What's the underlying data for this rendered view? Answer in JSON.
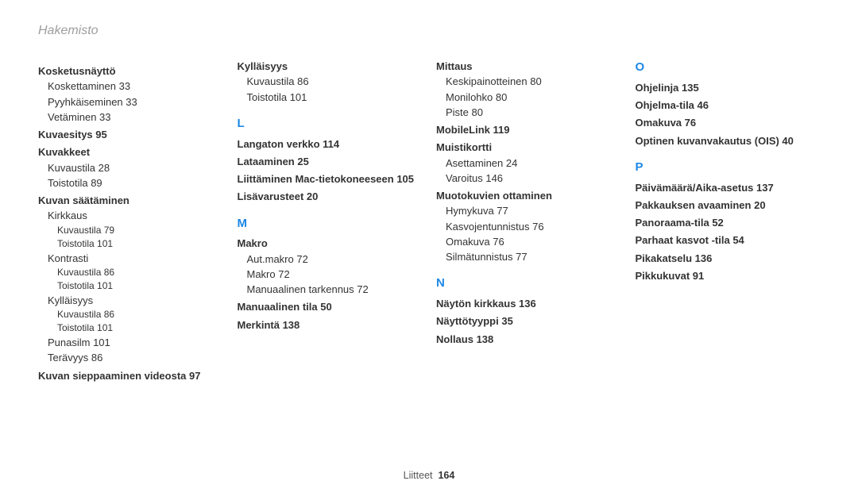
{
  "page_title": "Hakemisto",
  "footer": {
    "section": "Liitteet",
    "page": "164"
  },
  "col1": {
    "kosketusnaytto": "Kosketusnäyttö",
    "koskettaminen": "Koskettaminen  33",
    "pyyhkaiseminen": "Pyyhkäiseminen  33",
    "vetaminen": "Vetäminen  33",
    "kuvaesitys": "Kuvaesitys  95",
    "kuvakkeet": "Kuvakkeet",
    "kuvaustila28": "Kuvaustila  28",
    "toistotila89": "Toistotila  89",
    "kuvansaataminen": "Kuvan säätäminen",
    "kirkkaus": "Kirkkaus",
    "kuvaustila79": "Kuvaustila  79",
    "toistotila101a": "Toistotila  101",
    "kontrasti": "Kontrasti",
    "kuvaustila86a": "Kuvaustila  86",
    "toistotila101b": "Toistotila  101",
    "kyllaisyys": "Kylläisyys",
    "kuvaustila86b": "Kuvaustila  86",
    "toistotila101c": "Toistotila  101",
    "punasilm": "Punasilm  101",
    "teravyys": "Terävyys  86",
    "kuvansieppaaminen": "Kuvan sieppaaminen videosta  97"
  },
  "col2": {
    "kyllaisyys": "Kylläisyys",
    "kuvaustila86": "Kuvaustila  86",
    "toistotila101": "Toistotila  101",
    "L": "L",
    "langaton": "Langaton verkko  114",
    "lataaminen": "Lataaminen  25",
    "liittaminen": "Liittäminen Mac-tietokoneeseen  105",
    "lisavarusteet": "Lisävarusteet  20",
    "M": "M",
    "makro_hdr": "Makro",
    "autmakro": "Aut.makro  72",
    "makro72": "Makro  72",
    "manuaalinentarkennus": "Manuaalinen tarkennus  72",
    "manuaalinentila": "Manuaalinen tila  50",
    "merkinta": "Merkintä  138"
  },
  "col3": {
    "mittaus": "Mittaus",
    "keskipainotteinen": "Keskipainotteinen  80",
    "monilohko": "Monilohko  80",
    "piste": "Piste  80",
    "mobilelink": "MobileLink  119",
    "muistikortti": "Muistikortti",
    "asettaminen": "Asettaminen  24",
    "varoitus": "Varoitus  146",
    "muotokuvien": "Muotokuvien ottaminen",
    "hymykuva": "Hymykuva  77",
    "kasvojentunnistus": "Kasvojentunnistus  76",
    "omakuva76": "Omakuva  76",
    "silmatunnistus": "Silmätunnistus  77",
    "N": "N",
    "naytonkirkkaus": "Näytön kirkkaus  136",
    "nayttotyyppi": "Näyttötyyppi  35",
    "nollaus": "Nollaus  138"
  },
  "col4": {
    "O": "O",
    "ohjelinja": "Ohjelinja  135",
    "ohjelmatila": "Ohjelma-tila  46",
    "omakuva": "Omakuva  76",
    "optinen": "Optinen kuvanvakautus (OIS)  40",
    "P": "P",
    "paivamaara": "Päivämäärä/Aika-asetus  137",
    "pakkauksen": "Pakkauksen avaaminen  20",
    "panoraama": "Panoraama-tila  52",
    "parhaat": "Parhaat kasvot -tila  54",
    "pikakatselu": "Pikakatselu  136",
    "pikkukuvat": "Pikkukuvat  91"
  }
}
